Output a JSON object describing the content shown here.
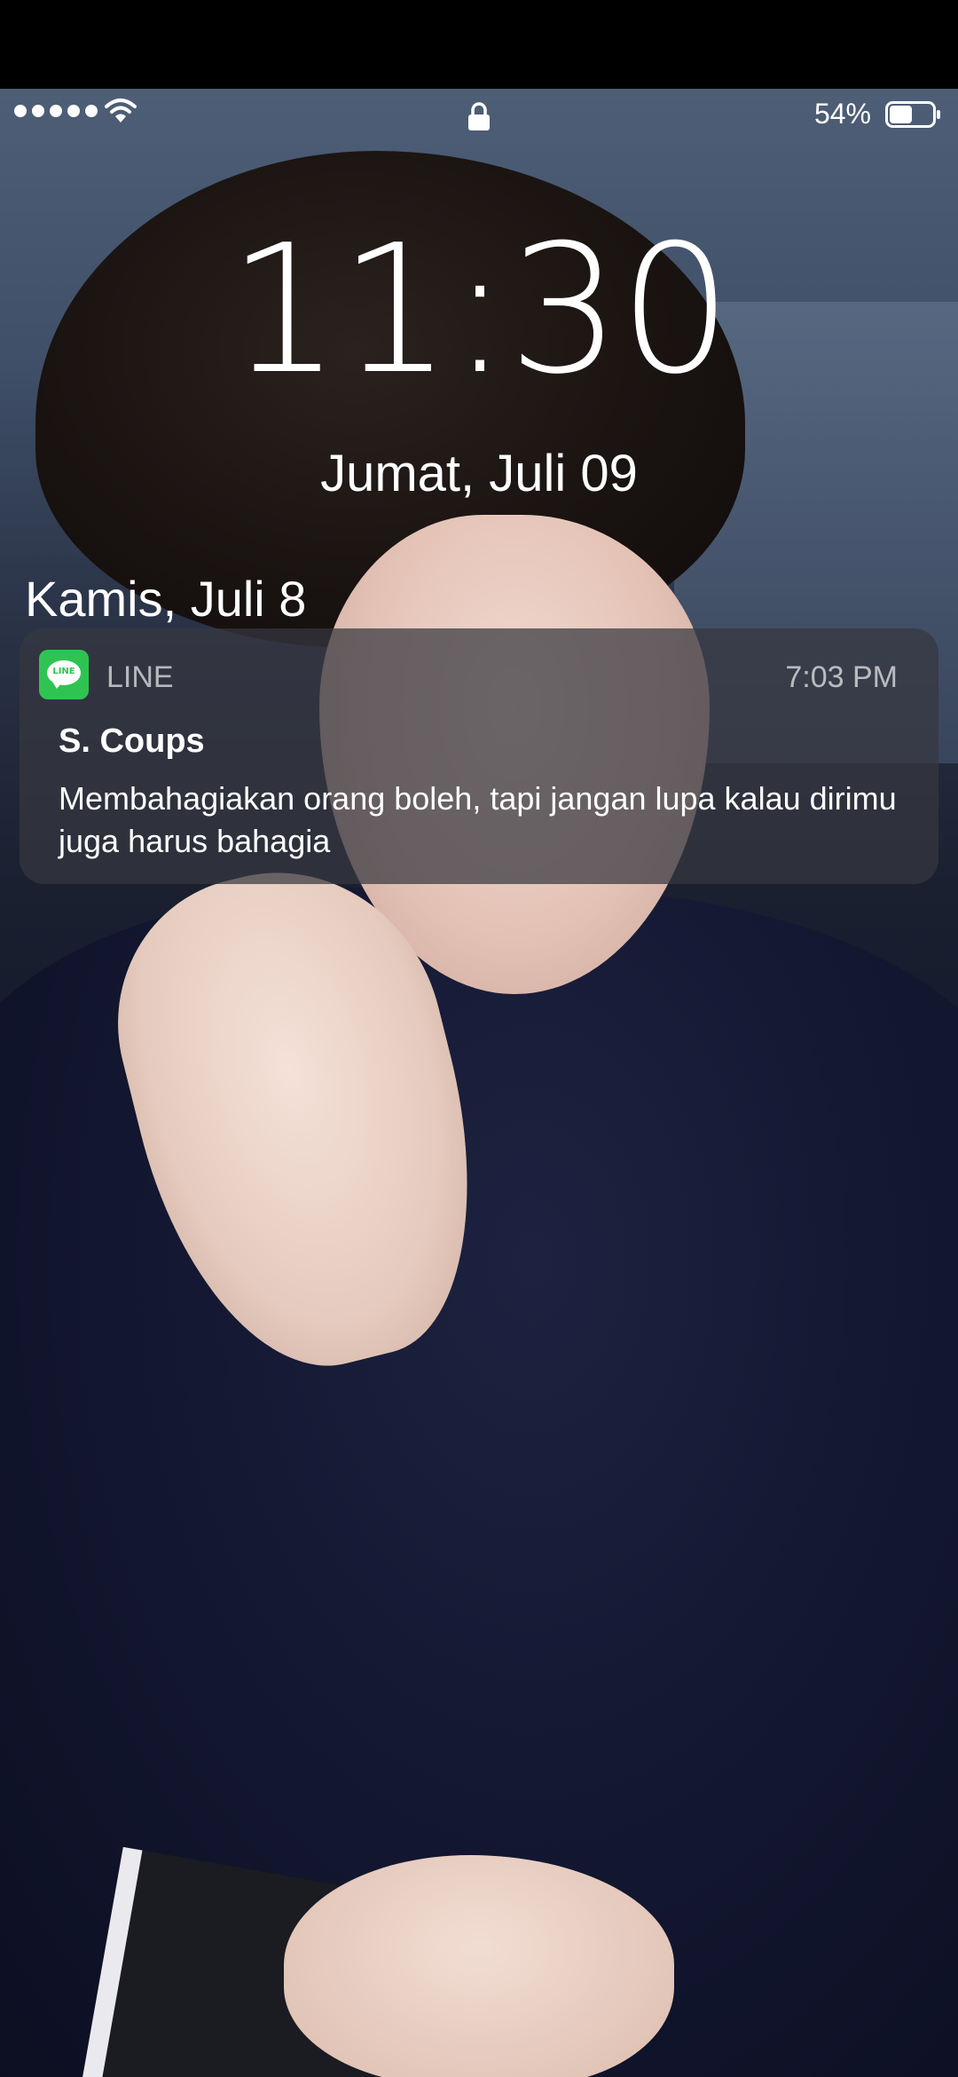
{
  "status_bar": {
    "battery_percent": "54%",
    "signal_dots": 5,
    "battery_level": 0.54
  },
  "lock_screen": {
    "time": "11:30",
    "date": "Jumat, Juli 09",
    "section_date": "Kamis, Juli 8"
  },
  "notification": {
    "app_name": "LINE",
    "app_logo_text": "LINE",
    "time": "7:03 PM",
    "sender": "S. Coups",
    "message": "Membahagiakan orang boleh, tapi jangan lupa kalau dirimu juga harus bahagia",
    "app_color": "#2fc451"
  },
  "icons": {
    "signal": "signal-dots-icon",
    "wifi": "wifi-icon",
    "lock": "lock-icon",
    "battery": "battery-icon",
    "app": "line-app-icon"
  }
}
